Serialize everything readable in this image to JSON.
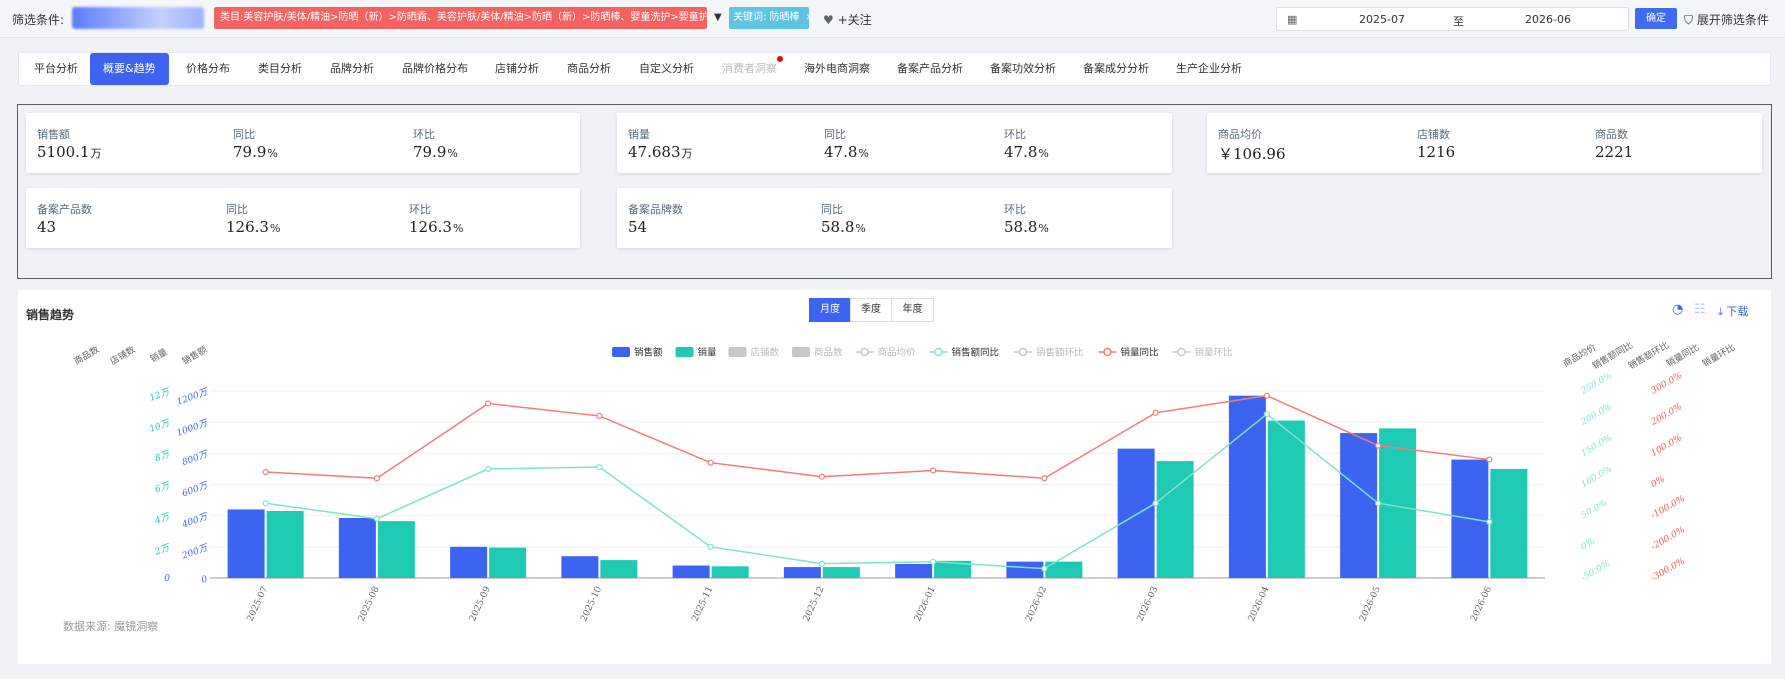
{
  "filter": {
    "label": "筛选条件:",
    "category_tag": "类目:美容护肤/美体/精油>防晒（新）>防晒霜、美容护肤/美体/精油>防晒（新）>防晒棒、婴童洗护>婴童护肤>婴童防晒",
    "keyword_tag": "关键词: 防晒棒",
    "follow_label": "+关注",
    "date_from": "2025-07",
    "date_sep": "至",
    "date_to": "2026-06",
    "confirm_label": "确定",
    "expand_label": "展开筛选条件"
  },
  "tabs": [
    {
      "label": "平台分析"
    },
    {
      "label": "概要&趋势",
      "active": true
    },
    {
      "label": "价格分布"
    },
    {
      "label": "类目分析"
    },
    {
      "label": "品牌分析"
    },
    {
      "label": "品牌价格分布"
    },
    {
      "label": "店铺分析"
    },
    {
      "label": "商品分析"
    },
    {
      "label": "自定义分析"
    },
    {
      "label": "消费者洞察",
      "disabled": true
    },
    {
      "label": "海外电商洞察"
    },
    {
      "label": "备案产品分析"
    },
    {
      "label": "备案功效分析"
    },
    {
      "label": "备案成分分析"
    },
    {
      "label": "生产企业分析"
    }
  ],
  "metrics": {
    "sales": {
      "label": "销售额",
      "value": "5100.1",
      "unit": "万",
      "yoy_label": "同比",
      "yoy": "79.9",
      "yoy_unit": "%",
      "mom_label": "环比",
      "mom": "79.9",
      "mom_unit": "%"
    },
    "volume": {
      "label": "销量",
      "value": "47.683",
      "unit": "万",
      "yoy_label": "同比",
      "yoy": "47.8",
      "yoy_unit": "%",
      "mom_label": "环比",
      "mom": "47.8",
      "mom_unit": "%"
    },
    "price": {
      "label": "商品均价",
      "value": "￥106.96",
      "shops_label": "店铺数",
      "shops": "1216",
      "items_label": "商品数",
      "items": "2221"
    },
    "filed_products": {
      "label": "备案产品数",
      "value": "43",
      "yoy_label": "同比",
      "yoy": "126.3",
      "yoy_unit": "%",
      "mom_label": "环比",
      "mom": "126.3",
      "mom_unit": "%"
    },
    "filed_brands": {
      "label": "备案品牌数",
      "value": "54",
      "yoy_label": "同比",
      "yoy": "58.8",
      "yoy_unit": "%",
      "mom_label": "环比",
      "mom": "58.8",
      "mom_unit": "%"
    }
  },
  "trend": {
    "title": "销售趋势",
    "periods": [
      {
        "label": "月度",
        "active": true
      },
      {
        "label": "季度"
      },
      {
        "label": "年度"
      }
    ],
    "download_label": "下载",
    "source": "数据来源: 魔镜洞察"
  },
  "colors": {
    "sales": "#3d64f0",
    "volume": "#1fcab5",
    "sales_yoy": "#7fe3cf",
    "volume_yoy": "#f47a74",
    "inactive": "#c8c8c8"
  },
  "chart_data": {
    "type": "bar",
    "categories": [
      "2025-07",
      "2025-08",
      "2025-09",
      "2025-10",
      "2025-11",
      "2025-12",
      "2026-01",
      "2026-02",
      "2026-03",
      "2026-04",
      "2026-05",
      "2026-06"
    ],
    "legend": [
      {
        "name": "销售额",
        "kind": "bar",
        "active": true
      },
      {
        "name": "销量",
        "kind": "bar",
        "active": true
      },
      {
        "name": "店铺数",
        "kind": "bar",
        "active": false
      },
      {
        "name": "商品数",
        "kind": "bar",
        "active": false
      },
      {
        "name": "商品均价",
        "kind": "line",
        "active": false
      },
      {
        "name": "销售额同比",
        "kind": "line",
        "active": true
      },
      {
        "name": "销售额环比",
        "kind": "line",
        "active": false
      },
      {
        "name": "销量同比",
        "kind": "line",
        "active": true
      },
      {
        "name": "销量环比",
        "kind": "line",
        "active": false
      }
    ],
    "series": [
      {
        "name": "销售额",
        "type": "bar",
        "axis": "sales",
        "values": [
          440,
          385,
          200,
          140,
          80,
          70,
          90,
          105,
          830,
          1170,
          930,
          760
        ]
      },
      {
        "name": "销量",
        "type": "bar",
        "axis": "volume",
        "values": [
          4.3,
          3.65,
          1.95,
          1.15,
          0.75,
          0.7,
          1.1,
          1.05,
          7.5,
          10.1,
          9.6,
          7.0
        ]
      },
      {
        "name": "销售额同比",
        "type": "line",
        "axis": "sales_yoy",
        "values": [
          70,
          45,
          125,
          128,
          0,
          -27,
          -24,
          -35,
          70,
          213,
          70,
          40
        ]
      },
      {
        "name": "销量同比",
        "type": "line",
        "axis": "volume_yoy",
        "values": [
          40,
          20,
          260,
          220,
          70,
          25,
          45,
          20,
          230,
          285,
          125,
          80
        ]
      }
    ],
    "axes": {
      "left_titles": [
        "商品数",
        "店铺数",
        "销量",
        "销售额"
      ],
      "right_titles": [
        "商品均价",
        "销售额同比",
        "销售额环比",
        "销量同比",
        "销量环比"
      ],
      "sales_ticks": [
        "0",
        "200万",
        "400万",
        "600万",
        "800万",
        "1000万",
        "1200万"
      ],
      "sales_range": [
        0,
        1200
      ],
      "volume_ticks": [
        "2万",
        "4万",
        "6万",
        "8万",
        "10万",
        "12万"
      ],
      "volume_range": [
        0,
        12
      ],
      "sales_yoy_ticks": [
        "-50.0%",
        "0%",
        "50.0%",
        "100.0%",
        "150.0%",
        "200.0%",
        "250.0%"
      ],
      "sales_yoy_range": [
        -50,
        250
      ],
      "volume_yoy_ticks": [
        "-300.0%",
        "-200.0%",
        "-100.0%",
        "0%",
        "100.0%",
        "200.0%",
        "300.0%"
      ],
      "volume_yoy_range": [
        -300,
        300
      ]
    },
    "grid": true
  }
}
